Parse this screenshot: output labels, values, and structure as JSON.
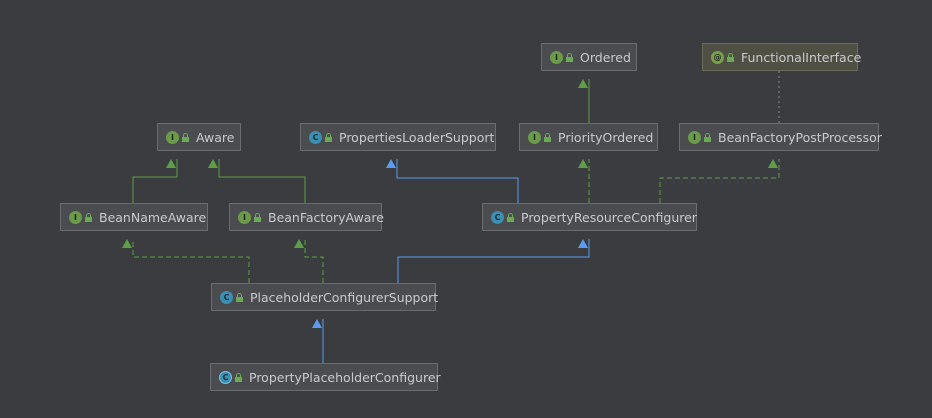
{
  "nodes": [
    {
      "id": "ordered",
      "label": "Ordered",
      "kind": "interface",
      "badge": "I",
      "icon": "interface-icon"
    },
    {
      "id": "functional_interface",
      "label": "FunctionalInterface",
      "kind": "annotation",
      "badge": "@",
      "icon": "annotation-icon"
    },
    {
      "id": "aware",
      "label": "Aware",
      "kind": "interface",
      "badge": "I",
      "icon": "interface-icon"
    },
    {
      "id": "properties_loader_support",
      "label": "PropertiesLoaderSupport",
      "kind": "abstract-class",
      "badge": "C",
      "icon": "abstract-class-icon"
    },
    {
      "id": "priority_ordered",
      "label": "PriorityOrdered",
      "kind": "interface",
      "badge": "I",
      "icon": "interface-icon"
    },
    {
      "id": "bean_factory_post_processor",
      "label": "BeanFactoryPostProcessor",
      "kind": "interface",
      "badge": "I",
      "icon": "interface-icon"
    },
    {
      "id": "bean_name_aware",
      "label": "BeanNameAware",
      "kind": "interface",
      "badge": "I",
      "icon": "interface-icon"
    },
    {
      "id": "bean_factory_aware",
      "label": "BeanFactoryAware",
      "kind": "interface",
      "badge": "I",
      "icon": "interface-icon"
    },
    {
      "id": "property_resource_configurer",
      "label": "PropertyResourceConfigurer",
      "kind": "abstract-class",
      "badge": "C",
      "icon": "abstract-class-icon"
    },
    {
      "id": "placeholder_configurer_support",
      "label": "PlaceholderConfigurerSupport",
      "kind": "abstract-class",
      "badge": "C",
      "icon": "abstract-class-icon"
    },
    {
      "id": "property_placeholder_configurer",
      "label": "PropertyPlaceholderConfigurer",
      "kind": "class",
      "badge": "C",
      "icon": "class-icon"
    }
  ],
  "edges": [
    {
      "from": "priority_ordered",
      "to": "ordered",
      "type": "extends-interface"
    },
    {
      "from": "bean_factory_post_processor",
      "to": "functional_interface",
      "type": "annotated-by"
    },
    {
      "from": "bean_name_aware",
      "to": "aware",
      "type": "extends-interface"
    },
    {
      "from": "bean_factory_aware",
      "to": "aware",
      "type": "extends-interface"
    },
    {
      "from": "property_resource_configurer",
      "to": "properties_loader_support",
      "type": "extends-class"
    },
    {
      "from": "property_resource_configurer",
      "to": "priority_ordered",
      "type": "implements"
    },
    {
      "from": "property_resource_configurer",
      "to": "bean_factory_post_processor",
      "type": "implements"
    },
    {
      "from": "placeholder_configurer_support",
      "to": "bean_name_aware",
      "type": "implements"
    },
    {
      "from": "placeholder_configurer_support",
      "to": "bean_factory_aware",
      "type": "implements"
    },
    {
      "from": "placeholder_configurer_support",
      "to": "property_resource_configurer",
      "type": "extends-class"
    },
    {
      "from": "property_placeholder_configurer",
      "to": "placeholder_configurer_support",
      "type": "extends-class"
    }
  ],
  "colors": {
    "background": "#3b3c3f",
    "extends_class": "#5b9bef",
    "interface_link": "#5e9e46",
    "annotation_link": "#8a8a8a"
  }
}
